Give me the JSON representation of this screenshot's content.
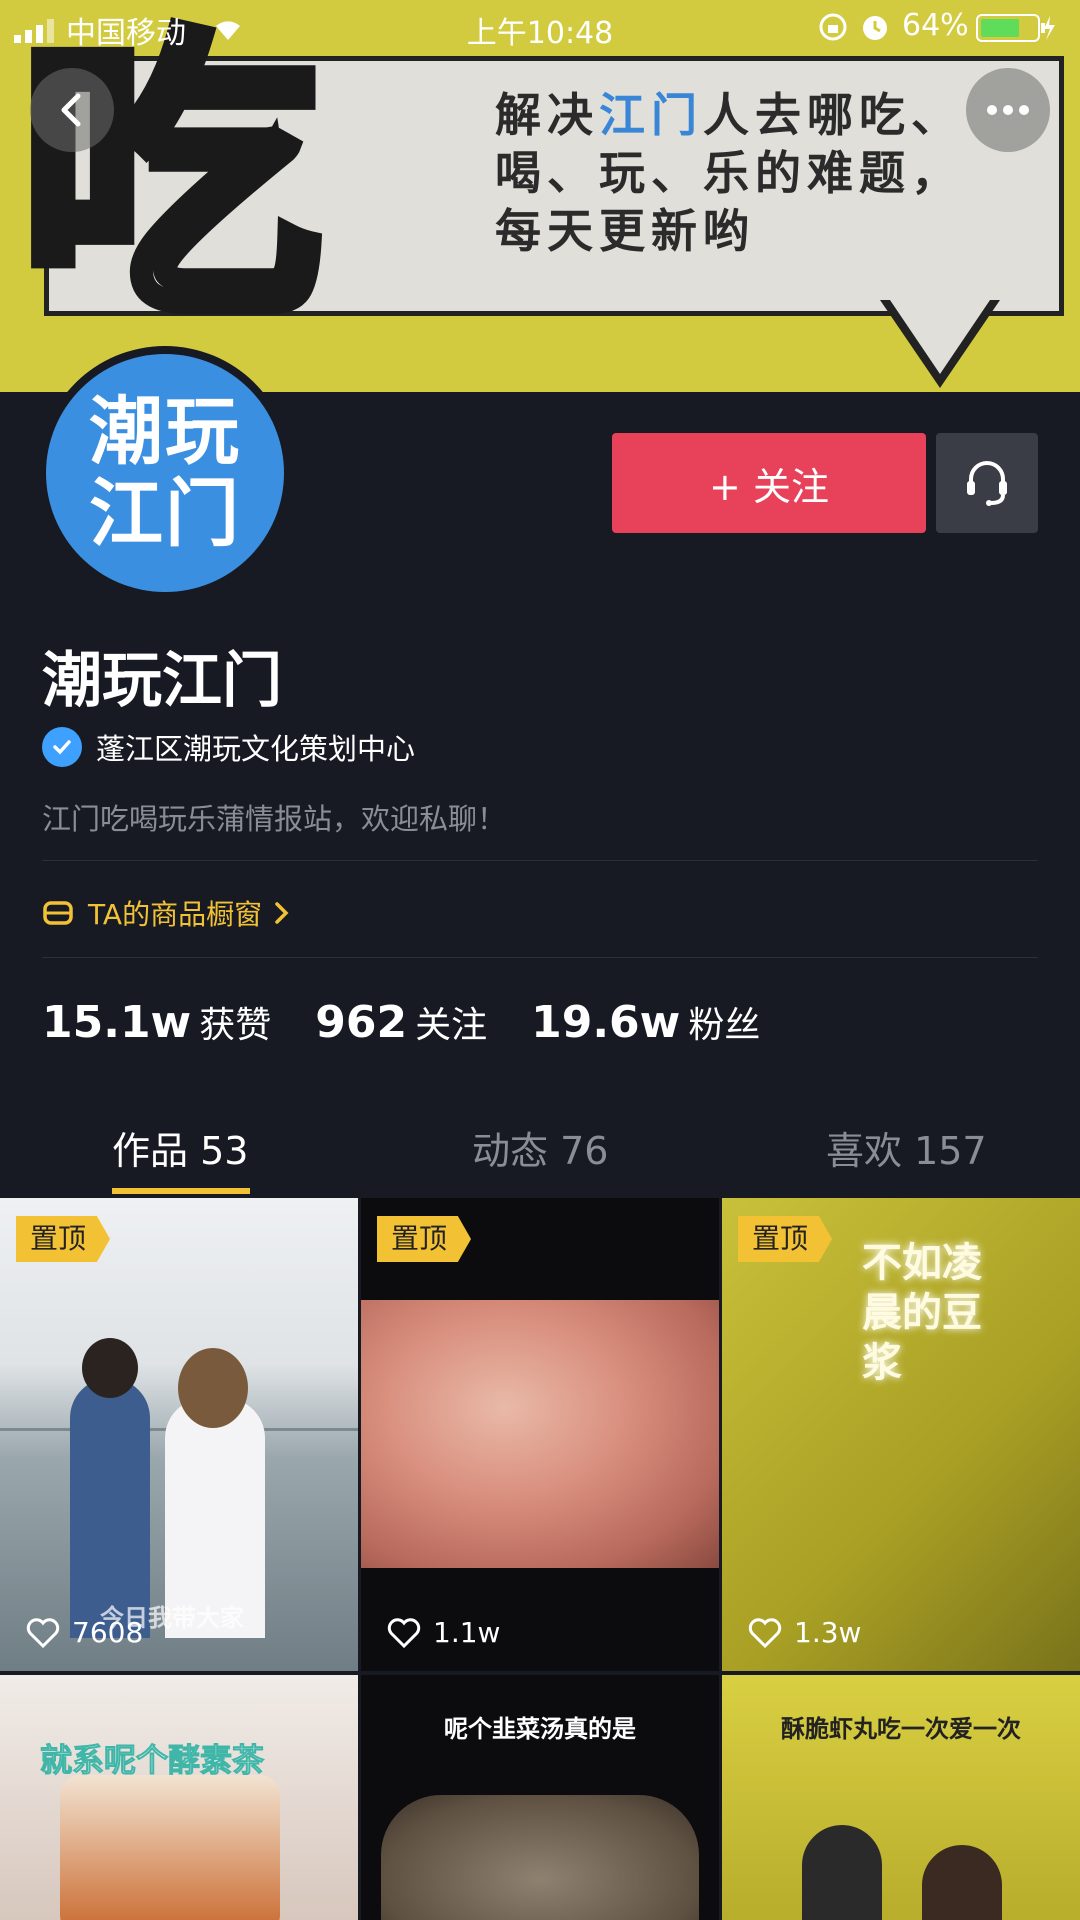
{
  "status_bar": {
    "carrier": "中国移动",
    "time": "上午10:48",
    "battery": "64%"
  },
  "banner": {
    "big_char": "吃",
    "line1_a": "解决",
    "line1_b": "江门",
    "line1_c": "人去哪吃、",
    "line2": "喝、玩、乐的难题，",
    "line3": "每天更新哟"
  },
  "avatar": {
    "line1": "潮玩",
    "line2": "江门"
  },
  "actions": {
    "follow_label": "+ 关注"
  },
  "profile": {
    "name": "潮玩江门",
    "verified_org": "蓬江区潮玩文化策划中心",
    "bio": "江门吃喝玩乐蒲情报站，欢迎私聊！",
    "shop_label": "TA的商品橱窗"
  },
  "stats": [
    {
      "num": "15.1w",
      "label": "获赞"
    },
    {
      "num": "962",
      "label": "关注"
    },
    {
      "num": "19.6w",
      "label": "粉丝"
    }
  ],
  "tabs": [
    {
      "label": "作品 53"
    },
    {
      "label": "动态 76"
    },
    {
      "label": "喜欢 157"
    }
  ],
  "videos": [
    {
      "pinned": "置顶",
      "likes": "7608",
      "caption": "今日我带大家"
    },
    {
      "pinned": "置顶",
      "likes": "1.1w"
    },
    {
      "pinned": "置顶",
      "likes": "1.3w",
      "caption": "不如凌晨的豆浆"
    },
    {
      "caption": "就系呢个酵素茶"
    },
    {
      "caption": "呢个韭菜汤真的是"
    },
    {
      "caption": "酥脆虾丸吃一次爱一次"
    }
  ]
}
